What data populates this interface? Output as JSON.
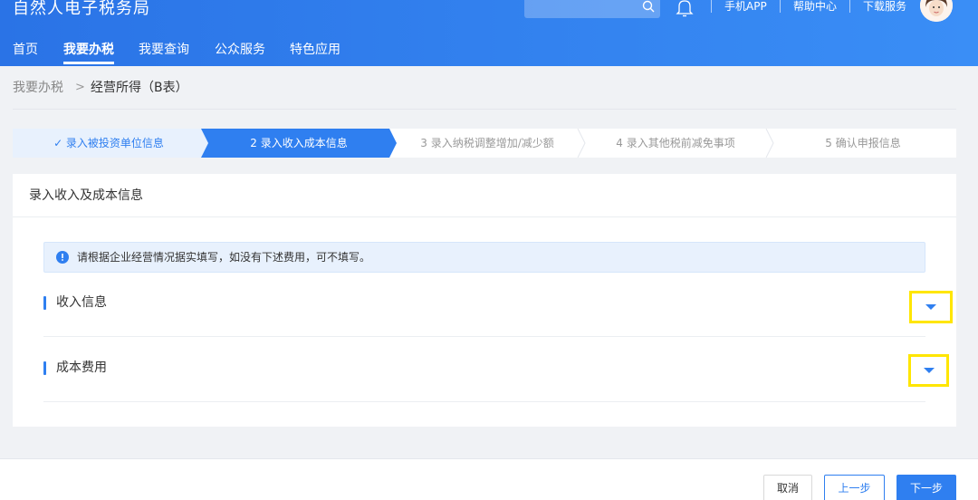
{
  "header": {
    "title": "自然人电子税务局",
    "links": [
      "手机APP",
      "帮助中心",
      "下载服务"
    ],
    "nav": [
      {
        "label": "首页",
        "active": false
      },
      {
        "label": "我要办税",
        "active": true
      },
      {
        "label": "我要查询",
        "active": false
      },
      {
        "label": "公众服务",
        "active": false
      },
      {
        "label": "特色应用",
        "active": false
      }
    ],
    "icons": {
      "search": "search-icon",
      "bell": "bell-icon",
      "avatar": "avatar"
    }
  },
  "breadcrumb": {
    "home": "我要办税",
    "separator": ">",
    "current": "经营所得（B表）"
  },
  "stepper": {
    "steps": [
      {
        "label": "✓ 录入被投资单位信息",
        "state": "done"
      },
      {
        "label": "2  录入收入成本信息",
        "state": "active"
      },
      {
        "label": "3  录入纳税调整增加/减少额",
        "state": "pending"
      },
      {
        "label": "4  录入其他税前减免事项",
        "state": "pending"
      },
      {
        "label": "5  确认申报信息",
        "state": "pending"
      }
    ]
  },
  "card": {
    "title": "录入收入及成本信息",
    "notice": "请根据企业经营情况据实填写，如没有下述费用，可不填写。",
    "sections": [
      {
        "title": "收入信息",
        "expand_icon": "caret-down-icon"
      },
      {
        "title": "成本费用",
        "expand_icon": "caret-down-icon"
      }
    ]
  },
  "footer": {
    "cancel": "取消",
    "prev": "上一步",
    "next": "下一步"
  },
  "colors": {
    "primary": "#2f7ff0",
    "header_bg": "#2a73e6",
    "highlight": "#ffe600",
    "done_step": "#e8f1fd"
  }
}
